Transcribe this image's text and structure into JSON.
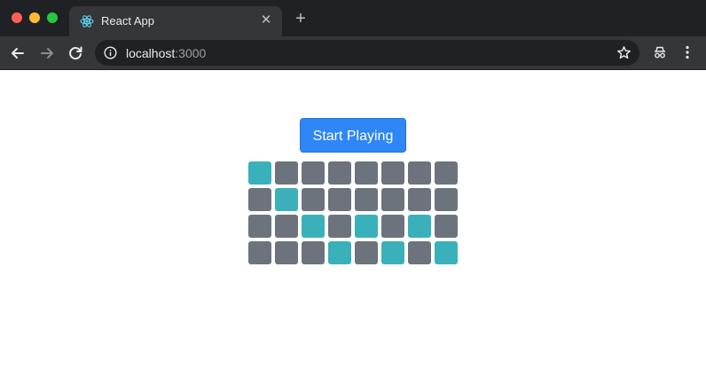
{
  "browser": {
    "tab": {
      "title": "React App",
      "favicon": "react-logo-icon",
      "close_glyph": "✕"
    },
    "new_tab_glyph": "+",
    "address": {
      "host": "localhost",
      "port": ":3000"
    },
    "icons": {
      "back": "arrow-left-icon",
      "forward": "arrow-right-icon",
      "reload": "reload-icon",
      "info": "info-icon",
      "bookmark": "star-icon",
      "extension": "incognito-icon",
      "menu": "kebab-menu-icon"
    }
  },
  "app": {
    "start_button_label": "Start Playing",
    "colors": {
      "button": "#2f86f5",
      "cell_active": "#3ab0ba",
      "cell_inactive": "#6c737d"
    },
    "grid": [
      [
        true,
        false,
        false,
        false,
        false,
        false,
        false,
        false
      ],
      [
        false,
        true,
        false,
        false,
        false,
        false,
        false,
        false
      ],
      [
        false,
        false,
        true,
        false,
        true,
        false,
        true,
        false
      ],
      [
        false,
        false,
        false,
        true,
        false,
        true,
        false,
        true
      ]
    ]
  }
}
